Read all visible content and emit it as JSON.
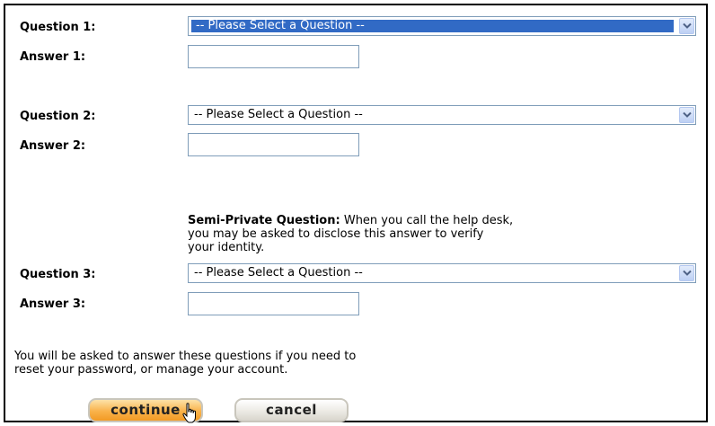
{
  "form": {
    "question1_label": "Question 1:",
    "answer1_label": "Answer 1:",
    "question2_label": "Question 2:",
    "answer2_label": "Answer 2:",
    "question3_label": "Question 3:",
    "answer3_label": "Answer 3:",
    "question1_value": "-- Please Select a Question --",
    "question2_value": "-- Please Select a Question --",
    "question3_value": "-- Please Select a Question --",
    "answer1_value": "",
    "answer2_value": "",
    "answer3_value": ""
  },
  "semi_private": {
    "title": "Semi-Private Question:",
    "text_line1": " When you call the help desk,",
    "text_line2": "you may be asked to disclose this answer to verify",
    "text_line3": "your identity."
  },
  "note": {
    "line1": "You will be asked to answer these questions if you need to",
    "line2": "reset your password, or manage your account."
  },
  "buttons": {
    "continue_label": "continue",
    "cancel_label": "cancel"
  },
  "colors": {
    "selection_highlight": "#316ac5",
    "continue_button": "#f9b24a",
    "cancel_button": "#eceae4",
    "field_border": "#7f9db9"
  },
  "icons": {
    "dropdown_arrow": "chevron-down-icon",
    "cursor": "hand-pointer-icon"
  }
}
